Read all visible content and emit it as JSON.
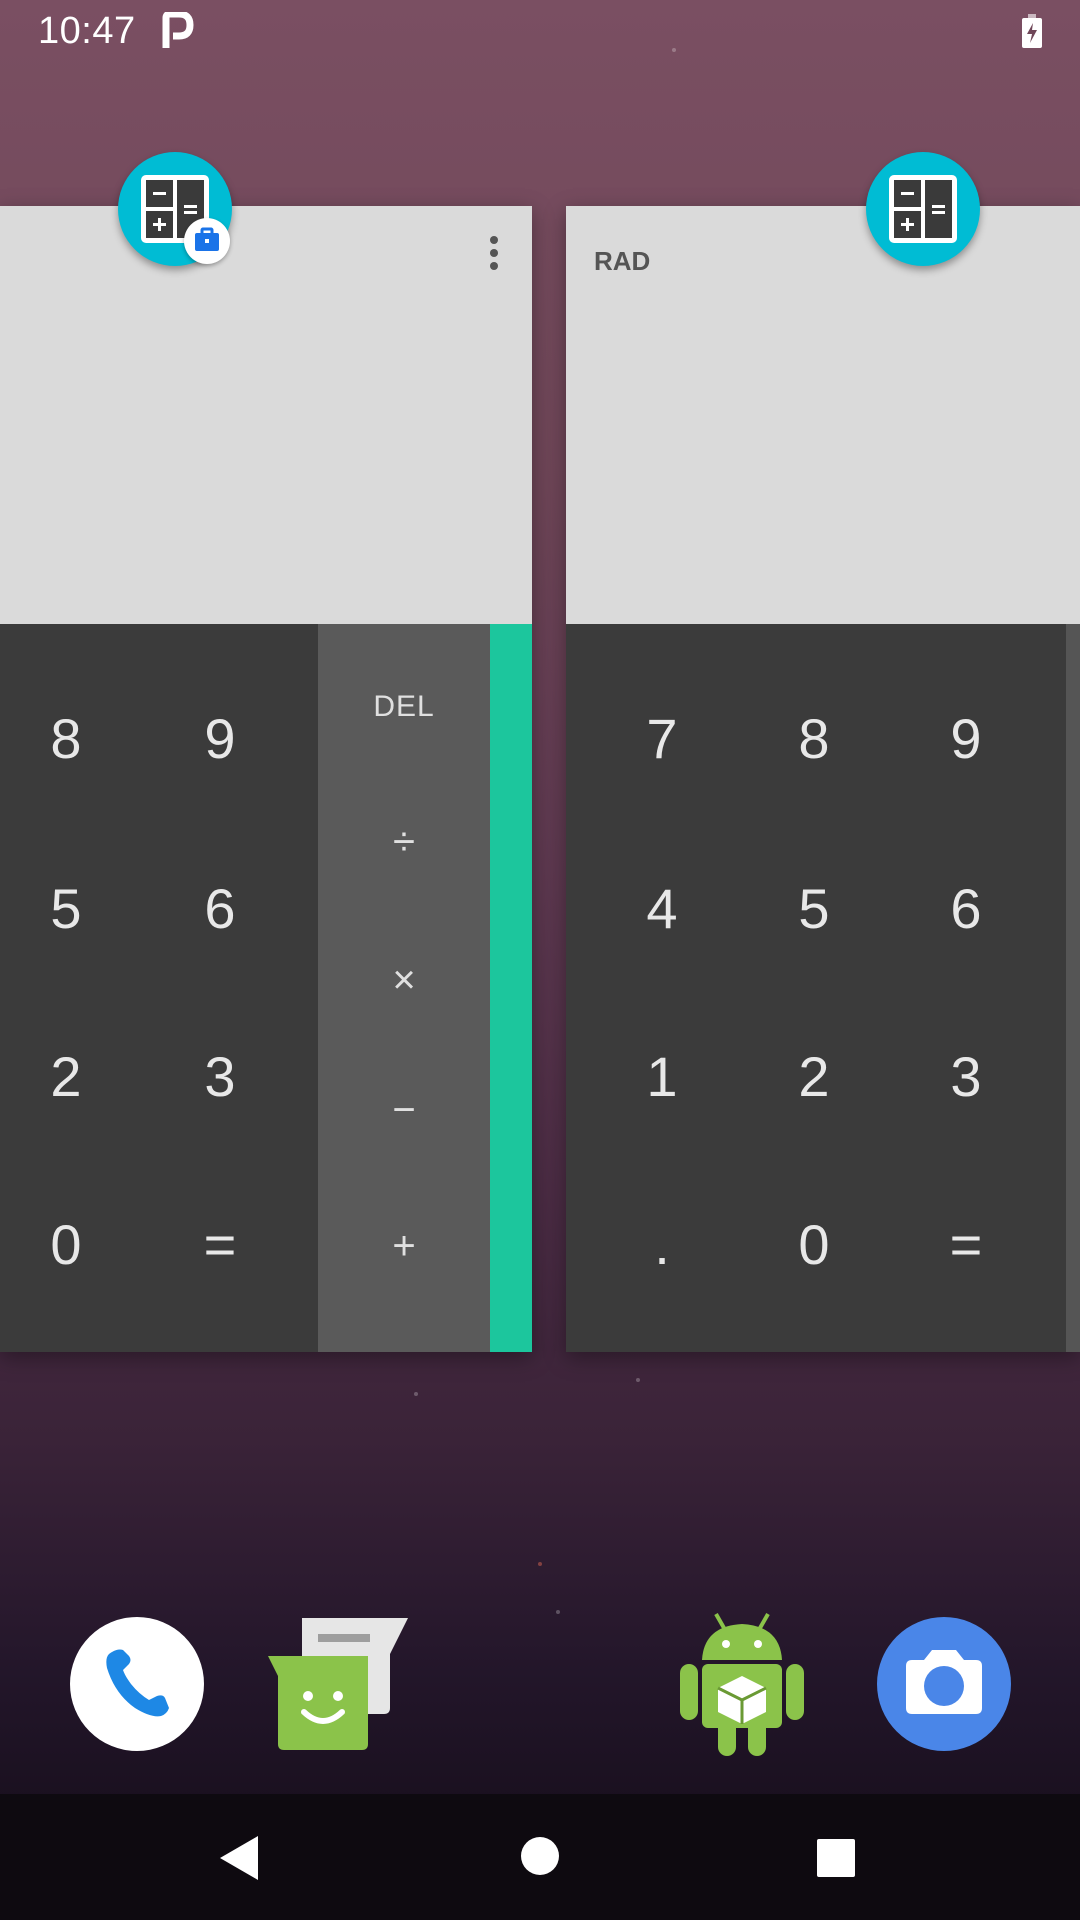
{
  "status_bar": {
    "time": "10:47",
    "notification_icon": "parking-p-icon",
    "battery_icon": "battery-charging-icon"
  },
  "recents": {
    "left_card": {
      "app_icon": "calculator-icon",
      "badge_icon": "work-briefcase-icon",
      "menu_icon": "more-vert-icon",
      "keys": [
        [
          "8",
          "9"
        ],
        [
          "5",
          "6"
        ],
        [
          "2",
          "3"
        ],
        [
          "0",
          "="
        ]
      ],
      "ops": [
        "DEL",
        "÷",
        "×",
        "−",
        "+"
      ],
      "accent_color": "#1cc69d"
    },
    "right_card": {
      "app_icon": "calculator-icon",
      "mode_label": "RAD",
      "keys": [
        [
          "7",
          "8",
          "9"
        ],
        [
          "4",
          "5",
          "6"
        ],
        [
          "1",
          "2",
          "3"
        ],
        [
          ".",
          "0",
          "="
        ]
      ]
    }
  },
  "dock": {
    "items": [
      {
        "name": "Phone",
        "icon": "phone-icon"
      },
      {
        "name": "Messaging",
        "icon": "messaging-icon"
      },
      {
        "name": "Android app",
        "icon": "android-cube-icon"
      },
      {
        "name": "Camera",
        "icon": "camera-icon"
      }
    ]
  },
  "nav_bar": {
    "back": "back-icon",
    "home": "home-icon",
    "recents": "recents-icon"
  },
  "colors": {
    "calculator_icon_bg": "#00bcd4",
    "display_bg": "#dadada",
    "keypad_bg": "#3b3b3b",
    "ops_bg": "#5a5a5a",
    "camera_bg": "#4a86e8",
    "messaging_green": "#8bc34a"
  }
}
